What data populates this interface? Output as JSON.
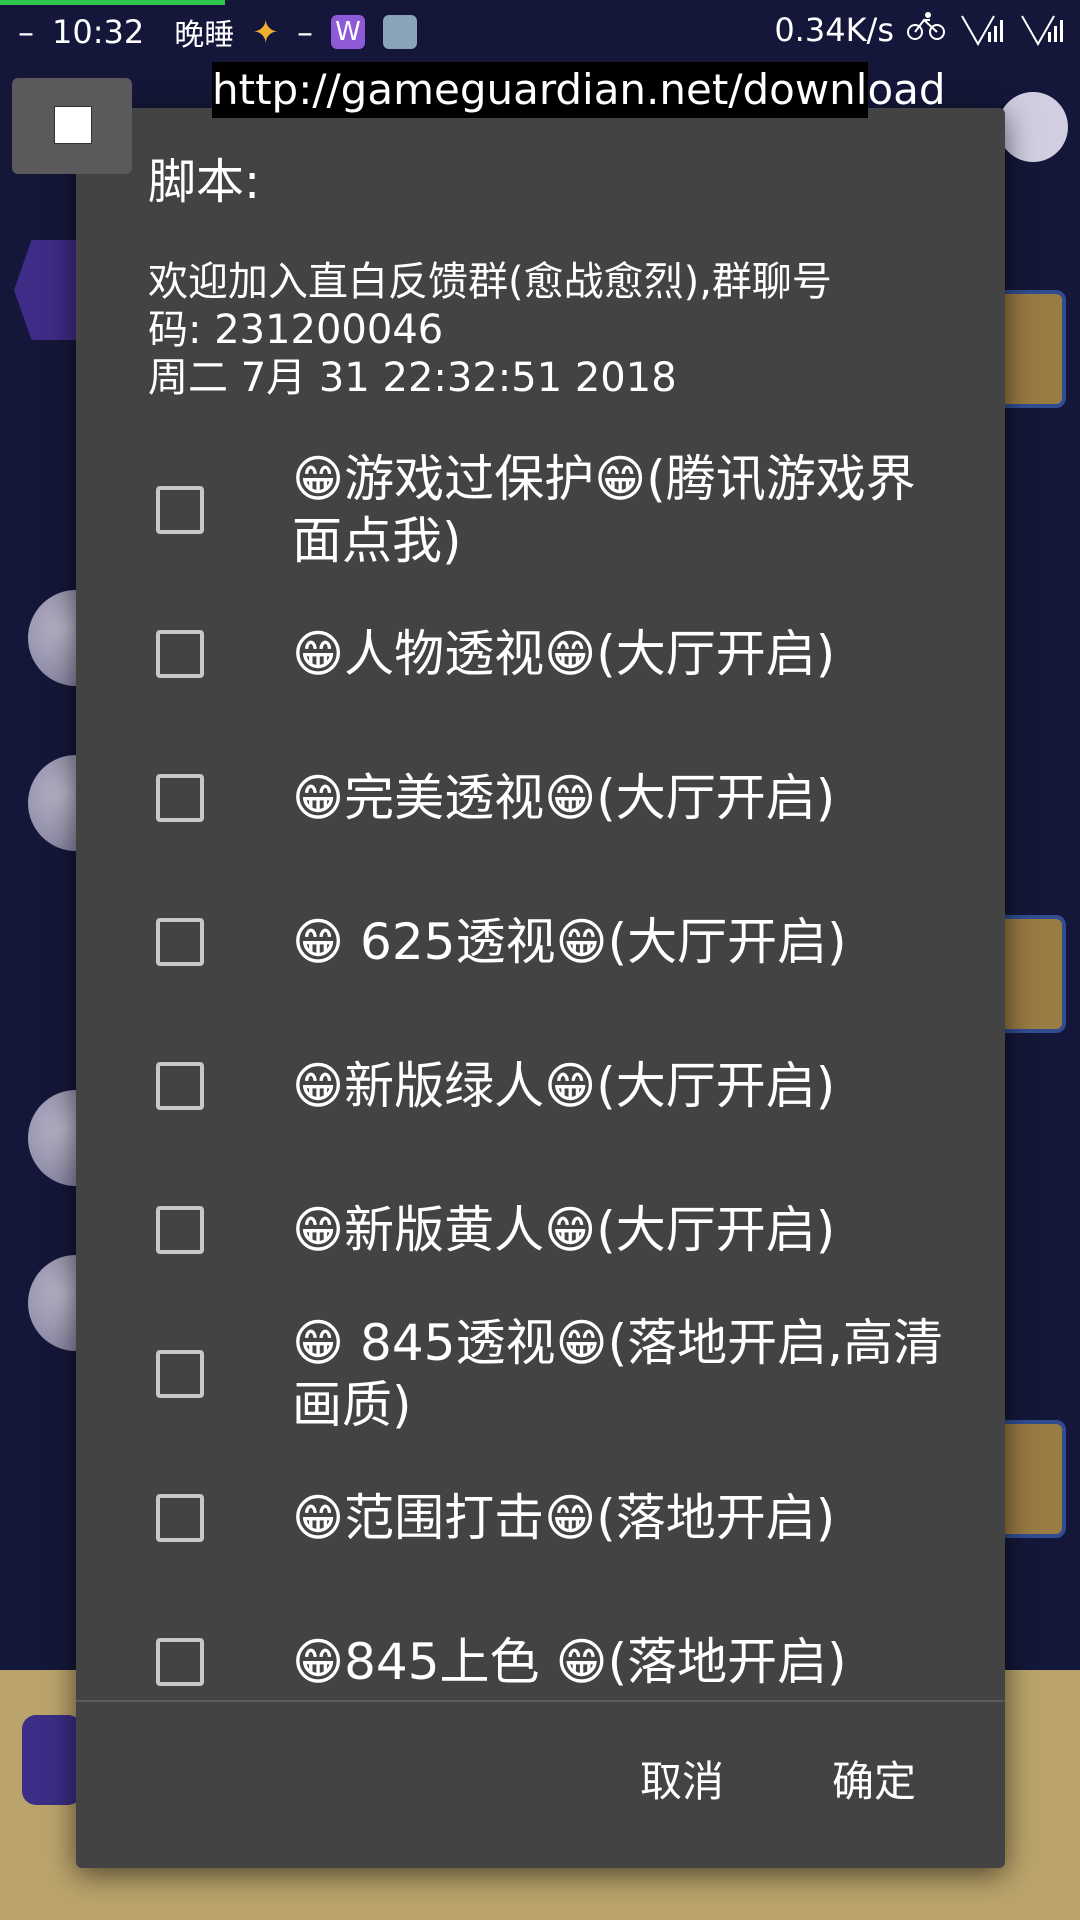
{
  "status_bar": {
    "time": "10:32",
    "dash_left": "–",
    "dash_mid": "–",
    "notification_text": "晚睡",
    "network_speed": "0.34K/s"
  },
  "url_banner": "http://gameguardian.net/download",
  "dialog": {
    "title": "脚本:",
    "message": "欢迎加入直白反馈群(愈战愈烈),群聊号\n码: 231200046\n周二 7月 31 22:32:51 2018",
    "options": [
      {
        "label": "😁游戏过保护😁(腾讯游戏界面点我)",
        "checked": false
      },
      {
        "label": "😁人物透视😁(大厅开启)",
        "checked": false
      },
      {
        "label": "😁完美透视😁(大厅开启)",
        "checked": false
      },
      {
        "label": "😁 625透视😁(大厅开启)",
        "checked": false
      },
      {
        "label": "😁新版绿人😁(大厅开启)",
        "checked": false
      },
      {
        "label": "😁新版黄人😁(大厅开启)",
        "checked": false
      },
      {
        "label": "😁 845透视😁(落地开启,高清画质)",
        "checked": false
      },
      {
        "label": "😁范围打击😁(落地开启)",
        "checked": false
      },
      {
        "label": "😁845上色 😁(落地开启)",
        "checked": false
      }
    ],
    "cancel_label": "取消",
    "ok_label": "确定"
  },
  "colors": {
    "dialog_bg": "#434343",
    "progress": "#2ec64b",
    "background": "#16183a"
  }
}
